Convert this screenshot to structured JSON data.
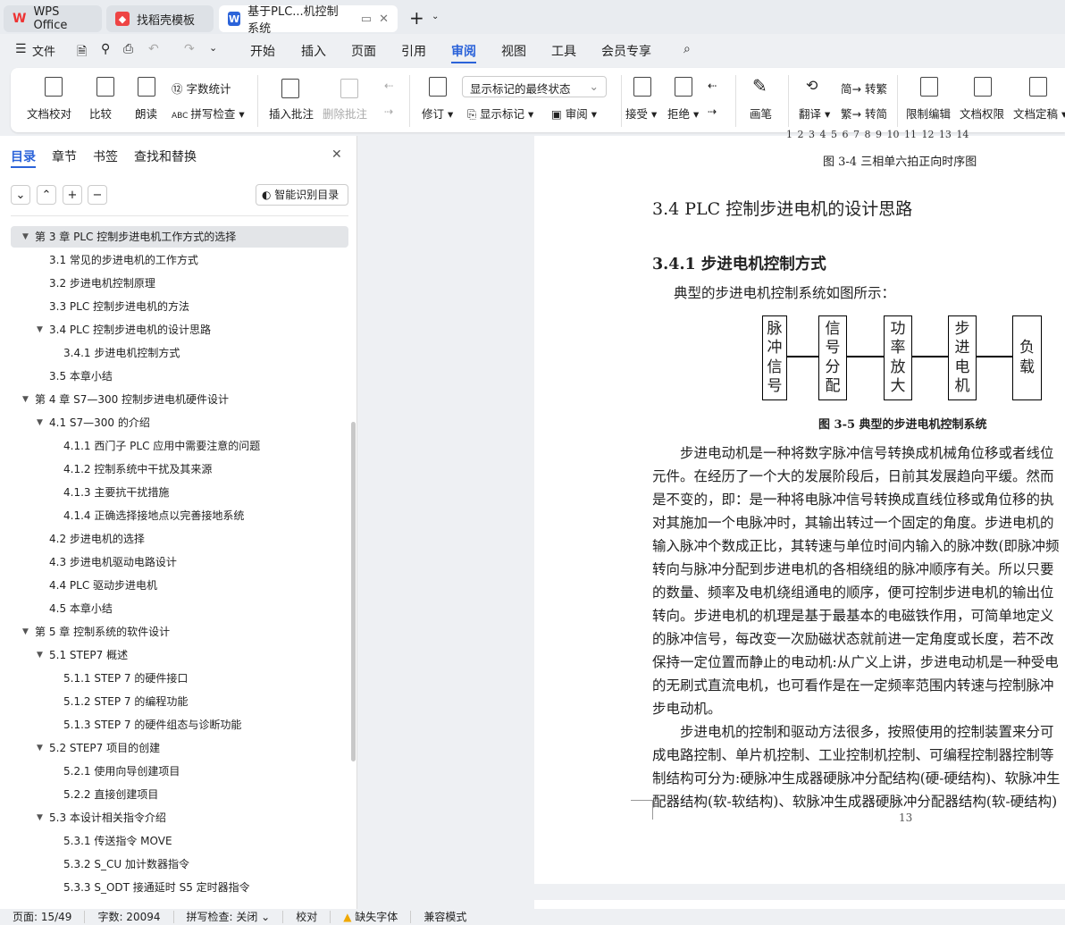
{
  "tabs": [
    {
      "label": "WPS Office"
    },
    {
      "label": "找稻壳模板"
    },
    {
      "label": "基于PLC...机控制系统"
    }
  ],
  "menu": {
    "file": "文件",
    "items": [
      "开始",
      "插入",
      "页面",
      "引用",
      "审阅",
      "视图",
      "工具",
      "会员专享"
    ],
    "active": "审阅"
  },
  "ribbon": {
    "proofread": "文档校对",
    "compare": "比较",
    "read": "朗读",
    "wordcount": "字数统计",
    "spell": "拼写检查",
    "insert_comment": "插入批注",
    "delete_comment": "删除批注",
    "revise": "修订",
    "markup_select": "显示标记的最终状态",
    "show_markup": "显示标记",
    "review": "审阅",
    "accept": "接受",
    "reject": "拒绝",
    "pen": "画笔",
    "translate": "翻译",
    "to_trad": "转繁",
    "to_simp": "转简",
    "restrict": "限制编辑",
    "permission": "文档权限",
    "finalize": "文档定稿"
  },
  "nav": {
    "tabs": [
      "目录",
      "章节",
      "书签",
      "查找和替换"
    ],
    "smart_toc": "智能识别目录",
    "items": [
      {
        "label": "第 3 章  PLC 控制步进电机工作方式的选择",
        "level": 1,
        "expanded": true,
        "selected": true
      },
      {
        "label": "3.1  常见的步进电机的工作方式",
        "level": 2
      },
      {
        "label": "3.2  步进电机控制原理",
        "level": 2
      },
      {
        "label": "3.3 PLC 控制步进电机的方法",
        "level": 2
      },
      {
        "label": "3.4 PLC 控制步进电机的设计思路",
        "level": 2,
        "expanded": true
      },
      {
        "label": "3.4.1  步进电机控制方式",
        "level": 3
      },
      {
        "label": "3.5  本章小结",
        "level": 2
      },
      {
        "label": "第 4 章  S7—300 控制步进电机硬件设计",
        "level": 1,
        "expanded": true
      },
      {
        "label": "4.1 S7—300 的介绍",
        "level": 2,
        "expanded": true
      },
      {
        "label": "4.1.1  西门子  PLC  应用中需要注意的问题",
        "level": 3
      },
      {
        "label": "4.1.2  控制系统中干扰及其来源",
        "level": 3
      },
      {
        "label": "4.1.3  主要抗干扰措施",
        "level": 3
      },
      {
        "label": "4.1.4  正确选择接地点以完善接地系统",
        "level": 3
      },
      {
        "label": "4.2  步进电机的选择",
        "level": 2
      },
      {
        "label": "4.3  步进电机驱动电路设计",
        "level": 2
      },
      {
        "label": "4.4 PLC 驱动步进电机",
        "level": 2
      },
      {
        "label": "4.5  本章小结",
        "level": 2
      },
      {
        "label": "第 5 章  控制系统的软件设计",
        "level": 1,
        "expanded": true
      },
      {
        "label": "5.1 STEP7 概述",
        "level": 2,
        "expanded": true
      },
      {
        "label": "5.1.1 STEP 7 的硬件接口",
        "level": 3
      },
      {
        "label": "5.1.2 STEP 7 的编程功能",
        "level": 3
      },
      {
        "label": "5.1.3 STEP 7 的硬件组态与诊断功能",
        "level": 3
      },
      {
        "label": "5.2 STEP7 项目的创建",
        "level": 2,
        "expanded": true
      },
      {
        "label": "5.2.1  使用向导创建项目",
        "level": 3
      },
      {
        "label": "5.2.2  直接创建项目",
        "level": 3
      },
      {
        "label": "5.3  本设计相关指令介绍",
        "level": 2,
        "expanded": true
      },
      {
        "label": "5.3.1  传送指令 MOVE",
        "level": 3
      },
      {
        "label": "5.3.2 S_CU  加计数器指令",
        "level": 3
      },
      {
        "label": "5.3.3 S_ODT 接通延时  S5  定时器指令",
        "level": 3
      }
    ]
  },
  "doc": {
    "axis_ticks": "1   2   3   4   5   6   7   8   9  10  11 12  13  14",
    "fig34": "图 3-4  三相单六拍正向时序图",
    "h2": "3.4 PLC 控制步进电机的设计思路",
    "h3": "3.4.1  步进电机控制方式",
    "intro": "典型的步进电机控制系统如图所示：",
    "boxes": [
      "脉冲信号",
      "信号分配",
      "功率放大",
      "步进电机",
      "负载"
    ],
    "fig35": "图 3-5  典型的步进电机控制系统",
    "lines": [
      "　　步进电动机是一种将数字脉冲信号转换成机械角位移或者线位",
      "元件。在经历了一个大的发展阶段后，日前其发展趋向平缓。然而",
      "是不变的，即：是一种将电脉冲信号转换成直线位移或角位移的执",
      "对其施加一个电脉冲时，其输出转过一个固定的角度。步进电机的",
      "输入脉冲个数成正比，其转速与单位时间内输入的脉冲数(即脉冲频",
      "转向与脉冲分配到步进电机的各相绕组的脉冲顺序有关。所以只要",
      "的数量、频率及电机绕组通电的顺序，便可控制步进电机的输出位",
      "转向。步进电机的机理是基于最基本的电磁铁作用，可简单地定义",
      "的脉冲信号，每改变一次励磁状态就前进一定角度或长度，若不改",
      "保持一定位置而静止的电动机:从广义上讲，步进电动机是一种受电",
      "的无刷式直流电机，也可看作是在一定频率范围内转速与控制脉冲",
      "步电动机。",
      "　　步进电机的控制和驱动方法很多，按照使用的控制装置来分可",
      "成电路控制、单片机控制、工业控制机控制、可编程控制器控制等",
      "制结构可分为:硬脉冲生成器硬脉冲分配结构(硬-硬结构)、软脉冲生",
      "配器结构(软-软结构)、软脉冲生成器硬脉冲分配器结构(软-硬结构)"
    ],
    "page_number": "13"
  },
  "status": {
    "page": "页面: 15/49",
    "words": "字数: 20094",
    "spell": "拼写检查: 关闭",
    "proof": "校对",
    "missing_font": "缺失字体",
    "compat": "兼容模式"
  }
}
